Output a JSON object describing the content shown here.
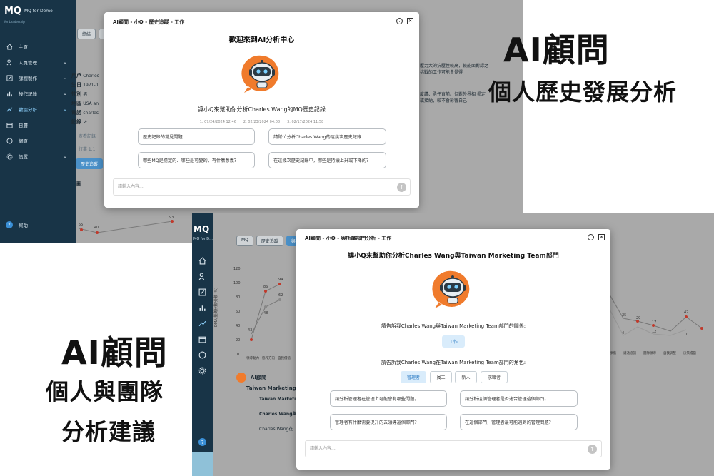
{
  "top_app": {
    "logo": "MQ",
    "app_name": "MQ for Demo",
    "tagline": "for Leadership",
    "nav": [
      {
        "label": "主頁",
        "icon": "home-icon",
        "chevron": ""
      },
      {
        "label": "人員管理",
        "icon": "users-icon",
        "chevron": "⌄"
      },
      {
        "label": "課程製作",
        "icon": "edit-icon",
        "chevron": "⌄"
      },
      {
        "label": "操作記錄",
        "icon": "bar-chart-icon",
        "chevron": "⌄"
      },
      {
        "label": "數據分析",
        "icon": "line-chart-icon",
        "chevron": "⌄"
      },
      {
        "label": "日曆",
        "icon": "calendar-icon",
        "chevron": ""
      },
      {
        "label": "網頁",
        "icon": "dollar-icon",
        "chevron": ""
      },
      {
        "label": "設置",
        "icon": "gear-icon",
        "chevron": "⌄"
      }
    ],
    "help": "幫助",
    "bg_tabs": [
      "總結",
      "數據"
    ],
    "bg_profile_labels": [
      "用戶",
      "生日",
      "性別",
      "地區",
      "電話",
      "記錄"
    ],
    "bg_profile_values": [
      "Charles",
      "1971-0",
      "男",
      "USA an",
      "charles",
      ""
    ],
    "bg_right_text": "壓力大的抗壓性較高，較能面對認之挑戰的工作可能會覺得",
    "bg_right_text2": "度謹、勇任直前。但對外界相 揭定或接納，較不會影響自己",
    "bg_link": "查看記錄",
    "bg_sub": "行業 1.1",
    "bg_btns": [
      "歷史追蹤",
      "與時"
    ],
    "bg_section": "圖",
    "bg_points": [
      "55",
      "40",
      "93"
    ]
  },
  "modal1": {
    "title": "AI顧問 - 小Q - 歷史追蹤 - 工作",
    "heading": "歡迎來到AI分析中心",
    "prompt": "讓小Q來幫助你分析Charles Wang的MQ歷史記錄",
    "dates": [
      "1. 07/24/2024 12:46",
      "2. 02/23/2024 04:08",
      "3. 02/17/2024 11:58"
    ],
    "questions": [
      "歷史記錄的常見問題",
      "請幫忙分析Charles Wang的這幾次歷史記錄",
      "哪些MQ是穩定的、哪些是可變的，有什麼意義？",
      "在這幾次歷史記錄中，哪些是持續上升或下降的？"
    ],
    "input_placeholder": "請輸入內容..."
  },
  "caption1": {
    "line1": "AI顧問",
    "line2": "個人歷史發展分析"
  },
  "caption2": {
    "line1": "AI顧問",
    "line2": "個人與團隊",
    "line3": "分析建議"
  },
  "bottom_app": {
    "logo": "MQ",
    "app_name": "MQ for D...",
    "tabs": [
      "MQ",
      "歷史追蹤",
      "與"
    ],
    "y_ticks": [
      "120",
      "100",
      "80",
      "60",
      "40",
      "20",
      "0"
    ],
    "y_label": "DMA/量測分數/分數 (%)",
    "x_ticks": [
      "領導動力",
      "協作方向",
      "自我價值"
    ],
    "left_values": [
      "94",
      "86",
      "62",
      "48",
      "43"
    ],
    "right_values": [
      "83",
      "35",
      "29",
      "17",
      "12",
      "42",
      "10",
      "4"
    ],
    "right_x_ticks": [
      "壓力承擔",
      "溝通協調",
      "團隊領導",
      "自我調整",
      "決策擔當"
    ],
    "ai_label": "AI顧問",
    "team_label": "Taiwan Marketing",
    "list": [
      "Taiwan Marketin",
      "Charles Wang與",
      "Charles Wang在"
    ]
  },
  "modal2": {
    "title": "AI顧問 - 小Q - 與所屬部門分析 - 工作",
    "heading": "讓小Q來幫助你分析Charles Wang與Taiwan Marketing Team部門",
    "relation_prompt": "請告訴我Charles Wang與Taiwan Marketing Team部門的關係:",
    "relation_option": "工作",
    "role_prompt": "請告訴我Charles Wang在Taiwan Marketing Team部門的角色:",
    "roles": [
      "管理者",
      "員工",
      "新人",
      "求職者"
    ],
    "questions": [
      "請分析管理者在管理上可能會有哪些問題。",
      "請分析這個管理者是否適合管理這個部門。",
      "管理者有什麼需要提升的去領導這個部門？",
      "在這個部門，管理者最可能遇到的管理問題？"
    ],
    "input_placeholder": "請輸入內容..."
  },
  "colors": {
    "sidebar": "#183447",
    "accent": "#8fd3ff",
    "robot_orange": "#f07b2c",
    "pill_selected": "#d9ecfb"
  }
}
